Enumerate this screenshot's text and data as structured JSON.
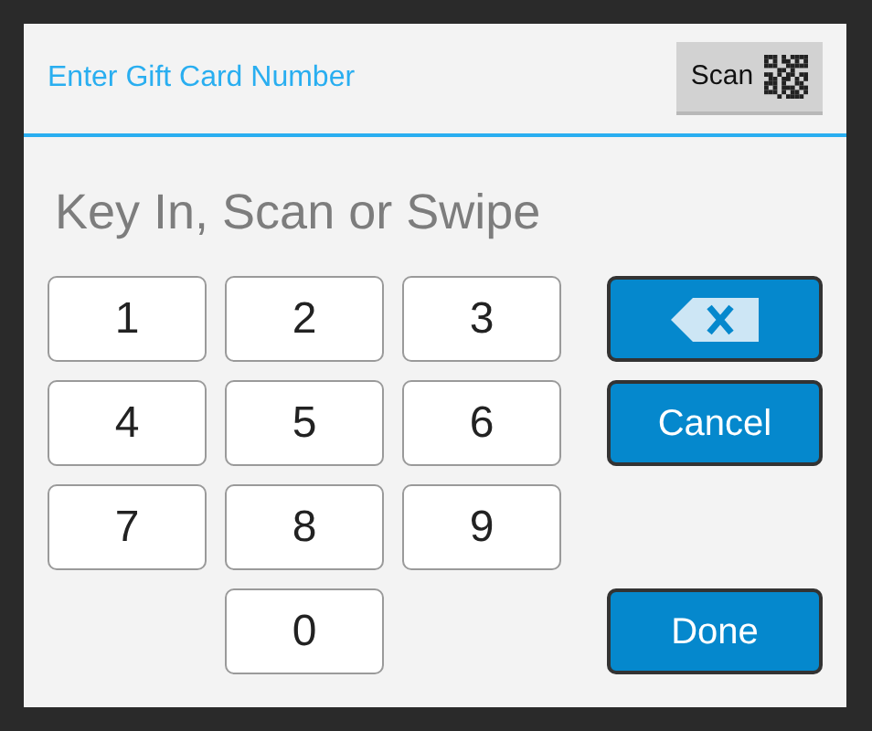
{
  "header": {
    "title": "Enter Gift Card Number",
    "scan_button": {
      "label": "Scan"
    }
  },
  "entry_field": {
    "placeholder": "Key In, Scan or Swipe"
  },
  "keys": [
    "1",
    "2",
    "3",
    "4",
    "5",
    "6",
    "7",
    "8",
    "9",
    "0"
  ],
  "actions": [
    {
      "kind": "backspace"
    },
    {
      "kind": "text",
      "label": "Cancel"
    },
    {
      "kind": "text",
      "label": "Done"
    }
  ]
}
